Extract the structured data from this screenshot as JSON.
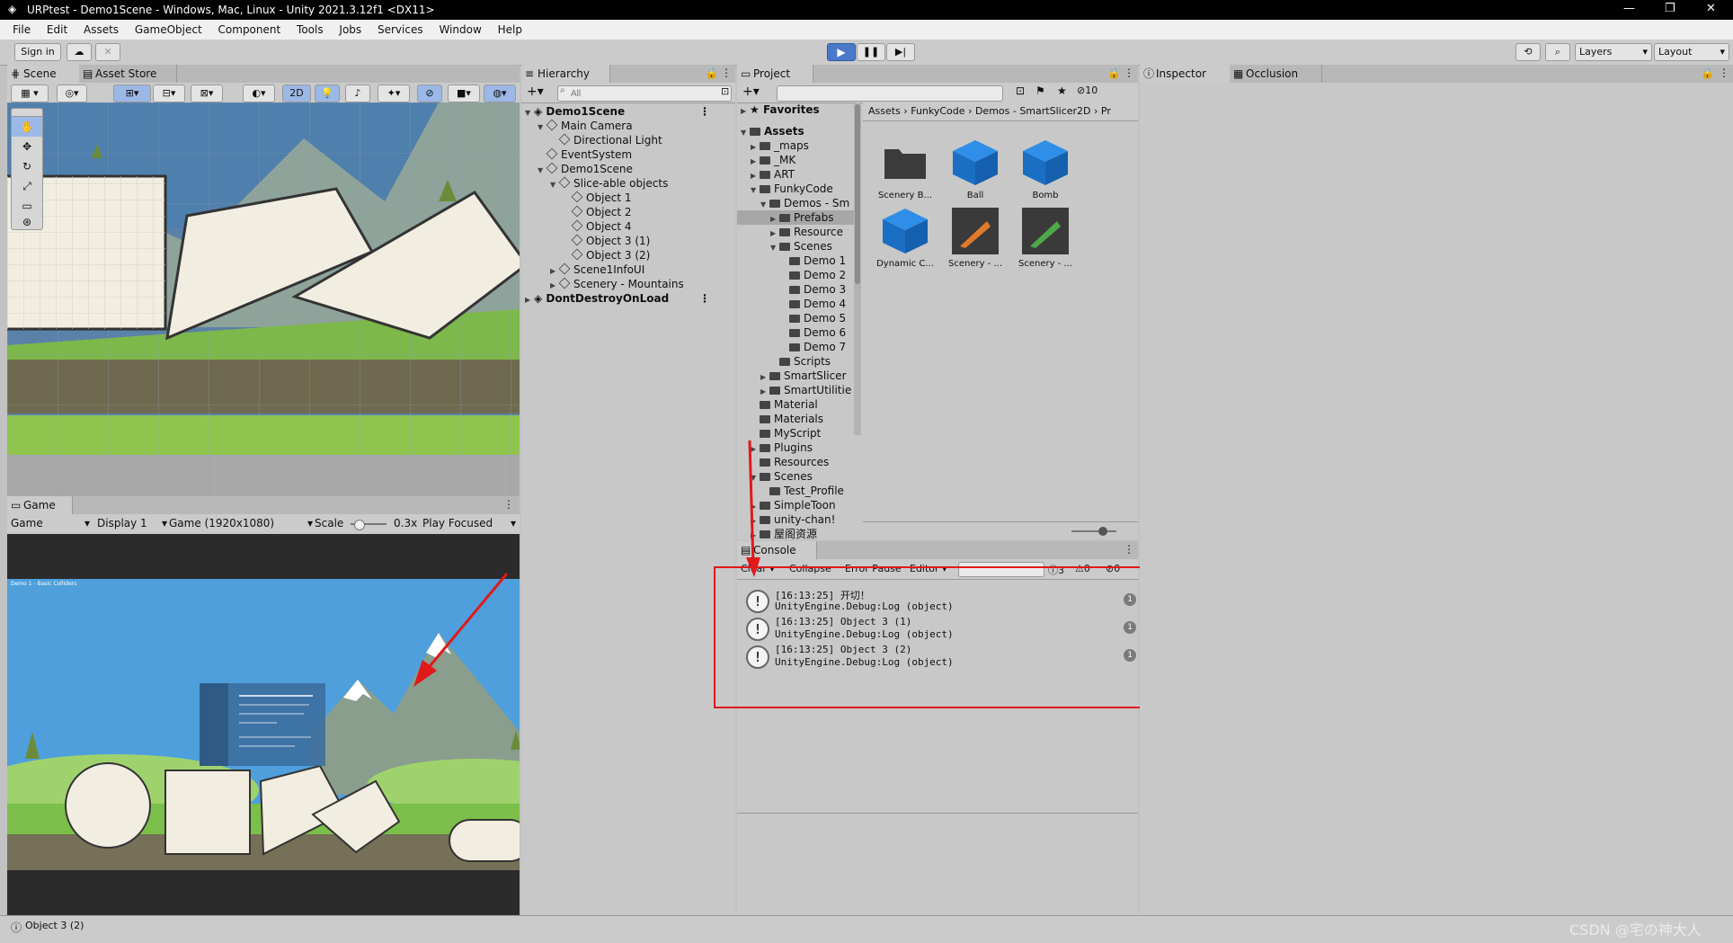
{
  "window": {
    "title": "URPtest - Demo1Scene - Windows, Mac, Linux - Unity 2021.3.12f1 <DX11>"
  },
  "menu": [
    "File",
    "Edit",
    "Assets",
    "GameObject",
    "Component",
    "Tools",
    "Jobs",
    "Services",
    "Window",
    "Help"
  ],
  "toolbar": {
    "sign_in": "Sign in",
    "layers": "Layers",
    "layout": "Layout"
  },
  "scene": {
    "tab_scene": "Scene",
    "tab_asset_store": "Asset Store",
    "mode_2d": "2D"
  },
  "game": {
    "tab": "Game",
    "display_mode": "Game",
    "display": "Display 1",
    "resolution": "Game (1920x1080)",
    "scale_label": "Scale",
    "scale_value": "0.3x",
    "play_mode": "Play Focused",
    "overlay_title": "Demo 1 - Basic Colliders"
  },
  "hierarchy": {
    "tab": "Hierarchy",
    "search_placeholder": "All",
    "rows": [
      {
        "label": "Demo1Scene",
        "depth": 0
      },
      {
        "label": "Main Camera",
        "depth": 1
      },
      {
        "label": "Directional Light",
        "depth": 2
      },
      {
        "label": "EventSystem",
        "depth": 1
      },
      {
        "label": "Demo1Scene",
        "depth": 1
      },
      {
        "label": "Slice-able objects",
        "depth": 2
      },
      {
        "label": "Object 1",
        "depth": 3
      },
      {
        "label": "Object 2",
        "depth": 3
      },
      {
        "label": "Object 4",
        "depth": 3
      },
      {
        "label": "Object 3 (1)",
        "depth": 3
      },
      {
        "label": "Object 3 (2)",
        "depth": 3
      },
      {
        "label": "Scene1InfoUI",
        "depth": 2
      },
      {
        "label": "Scenery - Mountains",
        "depth": 2
      },
      {
        "label": "DontDestroyOnLoad",
        "depth": 0
      }
    ]
  },
  "project": {
    "tab": "Project",
    "hidden_count": "10",
    "favorites": "Favorites",
    "assets_root": "Assets",
    "tree": [
      {
        "label": "_maps",
        "depth": 1
      },
      {
        "label": "_MK",
        "depth": 1
      },
      {
        "label": "ART",
        "depth": 1
      },
      {
        "label": "FunkyCode",
        "depth": 1
      },
      {
        "label": "Demos - Sm",
        "depth": 2
      },
      {
        "label": "Prefabs",
        "depth": 3
      },
      {
        "label": "Resource",
        "depth": 3
      },
      {
        "label": "Scenes",
        "depth": 3
      },
      {
        "label": "Demo 1",
        "depth": 4
      },
      {
        "label": "Demo 2",
        "depth": 4
      },
      {
        "label": "Demo 3",
        "depth": 4
      },
      {
        "label": "Demo 4",
        "depth": 4
      },
      {
        "label": "Demo 5",
        "depth": 4
      },
      {
        "label": "Demo 6",
        "depth": 4
      },
      {
        "label": "Demo 7",
        "depth": 4
      },
      {
        "label": "Scripts",
        "depth": 3
      },
      {
        "label": "SmartSlicer",
        "depth": 2
      },
      {
        "label": "SmartUtilitie",
        "depth": 2
      },
      {
        "label": "Material",
        "depth": 1
      },
      {
        "label": "Materials",
        "depth": 1
      },
      {
        "label": "MyScript",
        "depth": 1
      },
      {
        "label": "Plugins",
        "depth": 1
      },
      {
        "label": "Resources",
        "depth": 1
      },
      {
        "label": "Scenes",
        "depth": 1
      },
      {
        "label": "Test_Profile",
        "depth": 2
      },
      {
        "label": "SimpleToon",
        "depth": 1
      },
      {
        "label": "unity-chan!",
        "depth": 1
      },
      {
        "label": "屋阁资源",
        "depth": 1
      }
    ],
    "breadcrumb": [
      "Assets",
      "FunkyCode",
      "Demos - SmartSlicer2D",
      "Pr"
    ],
    "assets": [
      {
        "label": "Scenery B...",
        "kind": "folder"
      },
      {
        "label": "Ball",
        "kind": "cube"
      },
      {
        "label": "Bomb",
        "kind": "cube"
      },
      {
        "label": "Dynamic C...",
        "kind": "cube"
      },
      {
        "label": "Scenery - ...",
        "kind": "orange"
      },
      {
        "label": "Scenery - ...",
        "kind": "green"
      }
    ]
  },
  "console": {
    "tab": "Console",
    "clear": "Clear",
    "collapse": "Collapse",
    "error_pause": "Error Pause",
    "editor": "Editor",
    "log_count": "3",
    "warn_count": "0",
    "error_count": "0",
    "entries": [
      {
        "line1": "[16:13:25] 开切！",
        "line2": "UnityEngine.Debug:Log (object)",
        "count": "1"
      },
      {
        "line1": "[16:13:25] Object 3 (1)",
        "line2": "UnityEngine.Debug:Log (object)",
        "count": "1"
      },
      {
        "line1": "[16:13:25] Object 3 (2)",
        "line2": "UnityEngine.Debug:Log (object)",
        "count": "1"
      }
    ]
  },
  "inspector": {
    "tab": "Inspector",
    "tab_occlusion": "Occlusion"
  },
  "status": {
    "message": "Object 3 (2)",
    "watermark": "CSDN @宅の神大人"
  },
  "colors": {
    "highlight_red": "#e0191b",
    "play_blue": "#4a79c9",
    "sky": "#4e9fdc"
  }
}
